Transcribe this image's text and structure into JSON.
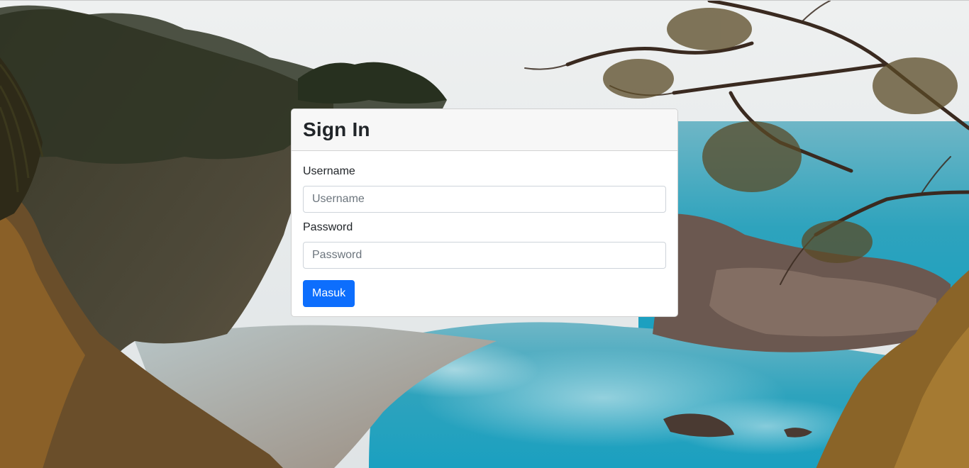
{
  "login": {
    "title": "Sign In",
    "username_label": "Username",
    "username_placeholder": "Username",
    "username_value": "",
    "password_label": "Password",
    "password_placeholder": "Password",
    "password_value": "",
    "submit_label": "Masuk"
  },
  "colors": {
    "primary_button": "#0d6efd",
    "card_header_bg": "#f7f7f7",
    "text": "#212529"
  },
  "background": {
    "icon": "coastal-landscape-photo"
  }
}
